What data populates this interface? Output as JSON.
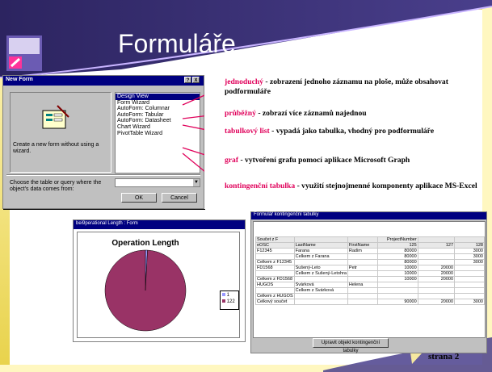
{
  "slide": {
    "title": "Formuláře",
    "page_label": "strana 2"
  },
  "dialog": {
    "title": "New Form",
    "help_btn": "?",
    "close_btn": "X",
    "description": "Create a new form without using a wizard.",
    "list_items": [
      "Design View",
      "Form Wizard",
      "AutoForm: Columnar",
      "AutoForm: Tabular",
      "AutoForm: Datasheet",
      "Chart Wizard",
      "PivotTable Wizard"
    ],
    "selected_item": "Design View",
    "choose_label": "Choose the table or query where the object's data comes from:",
    "ok_label": "OK",
    "cancel_label": "Cancel"
  },
  "annotations": [
    {
      "term": "jednoduchý",
      "text": " - zobrazení jednoho záznamu na ploše, může obsahovat podformuláře"
    },
    {
      "term": "průběžný",
      "text": " - zobrazí více záznamů najednou"
    },
    {
      "term": "tabulkový list",
      "text": " - vypadá jako tabulka, vhodný pro podformuláře"
    },
    {
      "term": "graf",
      "text": " - vytvoření grafu pomocí aplikace Microsoft Graph"
    },
    {
      "term": "kontingenční tabulka",
      "text": " - využití stejnojmenné komponenty aplikace MS-Excel"
    }
  ],
  "pie_window": {
    "title": "bei9perational Length : Form",
    "chart_title": "Operation Length",
    "legend": [
      "1",
      "122"
    ],
    "colors": {
      "slice_1": "#9999ff",
      "slice_122": "#993366"
    }
  },
  "pivot_window": {
    "title": "Formulář kontingenční tabulky",
    "column_field": "ProjectNumber",
    "header_row": [
      "Součet z F",
      "",
      "",
      "ProjectNumber",
      "",
      ""
    ],
    "row_field_headers": [
      "eOSC",
      "LastName",
      "FirstName",
      "125",
      "127",
      "128"
    ],
    "rows": [
      [
        "F12345",
        "Farana",
        "Radim",
        "80000",
        "",
        "3000"
      ],
      [
        "",
        "Celkem z Farana",
        "",
        "80000",
        "",
        "3000"
      ],
      [
        "Celkem z F12345",
        "",
        "",
        "80000",
        "",
        "3000"
      ],
      [
        "FD1568",
        "Sušený-Leto",
        "Petr",
        "10000",
        "20000",
        ""
      ],
      [
        "",
        "Celkem z Sušený-Letohra",
        "",
        "10000",
        "20000",
        ""
      ],
      [
        "Celkem z FD1568",
        "",
        "",
        "10000",
        "20000",
        ""
      ],
      [
        "HUGOS",
        "Svárková",
        "Helena",
        "",
        "",
        ""
      ],
      [
        "",
        "Celkem z Svárková",
        "",
        "",
        "",
        ""
      ],
      [
        "Celkem z HUGOS",
        "",
        "",
        "",
        "",
        ""
      ],
      [
        "Celkový součet",
        "",
        "",
        "90000",
        "20000",
        "3000"
      ]
    ],
    "edit_button": "Upravit objekt kontingenční tabulky"
  },
  "chart_data": {
    "type": "pie",
    "title": "Operation Length",
    "categories": [
      "1",
      "122"
    ],
    "values": [
      1,
      122
    ]
  }
}
